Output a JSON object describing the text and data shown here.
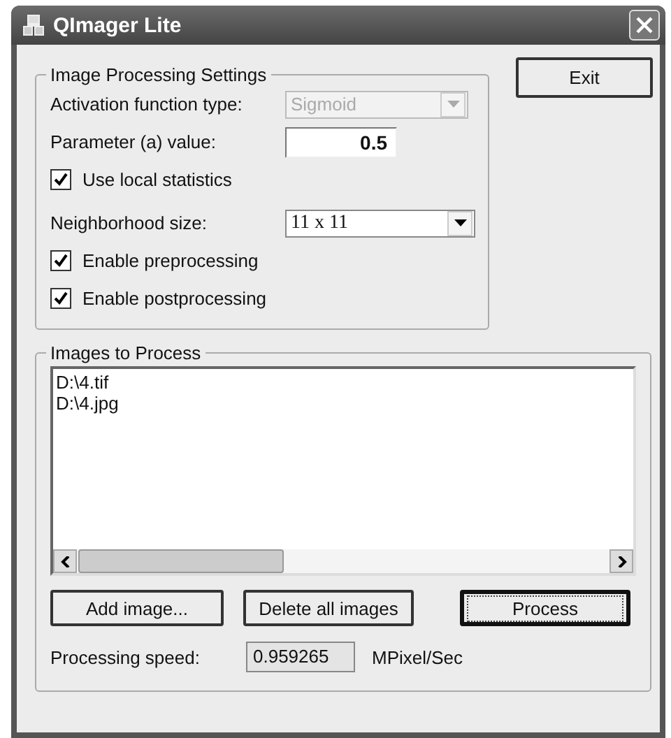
{
  "window": {
    "title": "QImager Lite"
  },
  "settings": {
    "title": "Image Processing Settings",
    "rows": [
      {
        "kind": "select",
        "label": "Activation function type:",
        "value": "Sigmoid",
        "disabled": true
      },
      {
        "kind": "input",
        "label": "Parameter (a) value:",
        "value": "0.5"
      },
      {
        "kind": "checkbox",
        "label": "Use local statistics",
        "checked": true
      },
      {
        "kind": "select",
        "label": "Neighborhood size:",
        "value": "11 x 11",
        "disabled": false
      },
      {
        "kind": "checkbox",
        "label": "Enable preprocessing",
        "checked": true
      },
      {
        "kind": "checkbox",
        "label": "Enable postprocessing",
        "checked": true
      }
    ]
  },
  "exit_button": "Exit",
  "images": {
    "title": "Images to Process",
    "items": [
      "D:\\4.tif",
      "D:\\4.jpg"
    ],
    "buttons": [
      {
        "label": "Add image...",
        "default": false
      },
      {
        "label": "Delete all images",
        "default": false
      },
      {
        "label": "Process",
        "default": true
      }
    ],
    "speed": {
      "label": "Processing speed:",
      "value": "0.959265",
      "unit": "MPixel/Sec"
    }
  }
}
